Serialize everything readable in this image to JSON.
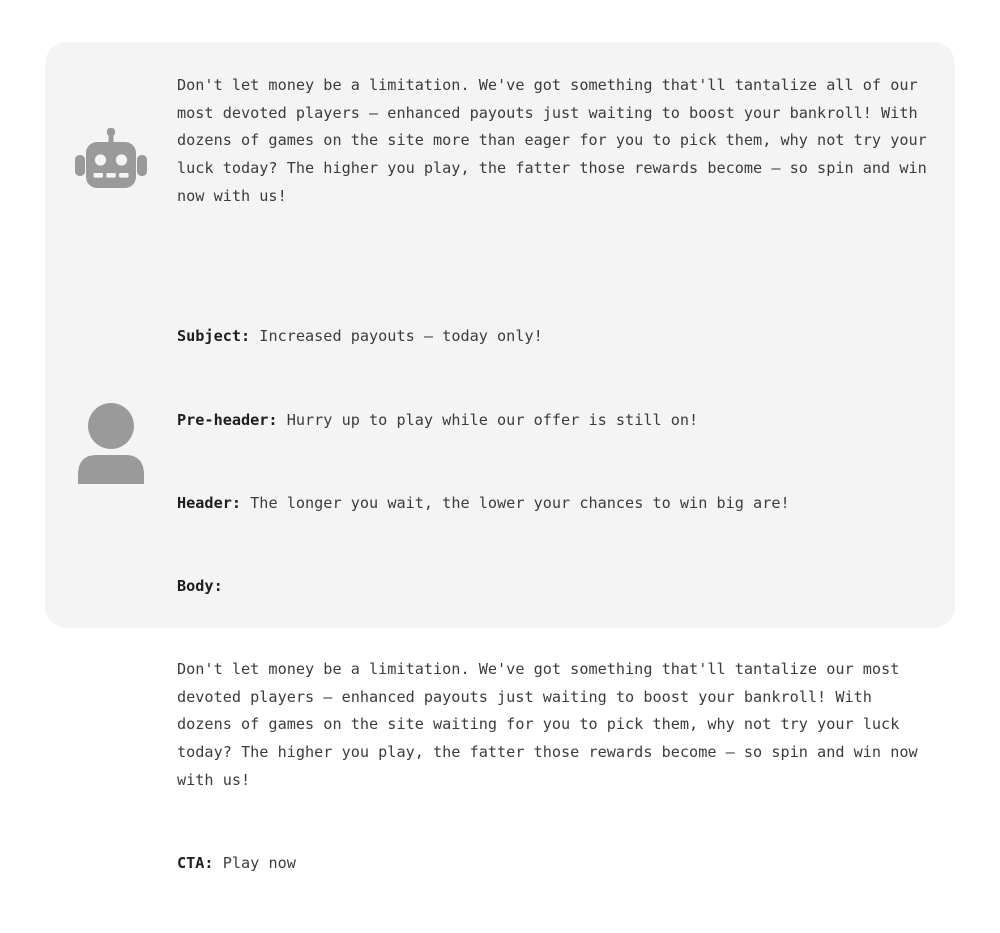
{
  "card": {
    "background_color": "#f4f4f4",
    "page_background_color": "#ffffff"
  },
  "messages": [
    {
      "role": "assistant",
      "avatar_icon": "robot-icon",
      "avatar_color": "#9a9a9a",
      "paragraphs": [
        "Don't let money be a limitation. We've got something that'll tantalize all of our most devoted players — enhanced payouts just waiting to boost your bankroll! With dozens of games on the site more than eager for you to pick them, why not try your luck today? The higher you play, the fatter those rewards become — so spin and win now with us!"
      ]
    },
    {
      "role": "user",
      "avatar_icon": "user-avatar-icon",
      "avatar_color": "#9a9a9a",
      "fields": [
        {
          "label": "Subject:",
          "value": " Increased payouts — today only!",
          "inline": true
        },
        {
          "label": "Pre-header:",
          "value": " Hurry up to play while our offer is still on!",
          "inline": true
        },
        {
          "label": "Header:",
          "value": " The longer you wait, the lower your chances to win big are!",
          "inline": true
        },
        {
          "label": "Body:",
          "value": "Don't let money be a limitation. We've got something that'll tantalize our most devoted players — enhanced payouts just waiting to boost your bankroll! With dozens of games on the site waiting for you to pick them, why not try your luck today? The higher you play, the fatter those rewards become — so spin and win now with us!",
          "inline": false
        },
        {
          "label": "CTA:",
          "value": " Play now",
          "inline": true
        }
      ]
    }
  ],
  "text": {
    "color": "#3c3c3c",
    "label_color": "#1e1e1e"
  }
}
